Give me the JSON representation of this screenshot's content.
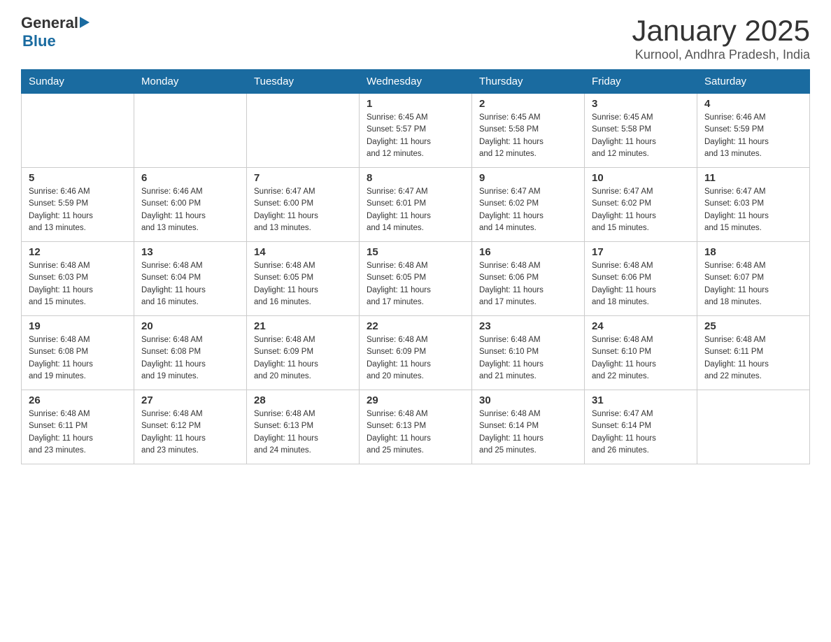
{
  "header": {
    "logo_general": "General",
    "logo_blue": "Blue",
    "month_title": "January 2025",
    "location": "Kurnool, Andhra Pradesh, India"
  },
  "days_of_week": [
    "Sunday",
    "Monday",
    "Tuesday",
    "Wednesday",
    "Thursday",
    "Friday",
    "Saturday"
  ],
  "weeks": [
    {
      "days": [
        {
          "date": "",
          "info": ""
        },
        {
          "date": "",
          "info": ""
        },
        {
          "date": "",
          "info": ""
        },
        {
          "date": "1",
          "info": "Sunrise: 6:45 AM\nSunset: 5:57 PM\nDaylight: 11 hours\nand 12 minutes."
        },
        {
          "date": "2",
          "info": "Sunrise: 6:45 AM\nSunset: 5:58 PM\nDaylight: 11 hours\nand 12 minutes."
        },
        {
          "date": "3",
          "info": "Sunrise: 6:45 AM\nSunset: 5:58 PM\nDaylight: 11 hours\nand 12 minutes."
        },
        {
          "date": "4",
          "info": "Sunrise: 6:46 AM\nSunset: 5:59 PM\nDaylight: 11 hours\nand 13 minutes."
        }
      ]
    },
    {
      "days": [
        {
          "date": "5",
          "info": "Sunrise: 6:46 AM\nSunset: 5:59 PM\nDaylight: 11 hours\nand 13 minutes."
        },
        {
          "date": "6",
          "info": "Sunrise: 6:46 AM\nSunset: 6:00 PM\nDaylight: 11 hours\nand 13 minutes."
        },
        {
          "date": "7",
          "info": "Sunrise: 6:47 AM\nSunset: 6:00 PM\nDaylight: 11 hours\nand 13 minutes."
        },
        {
          "date": "8",
          "info": "Sunrise: 6:47 AM\nSunset: 6:01 PM\nDaylight: 11 hours\nand 14 minutes."
        },
        {
          "date": "9",
          "info": "Sunrise: 6:47 AM\nSunset: 6:02 PM\nDaylight: 11 hours\nand 14 minutes."
        },
        {
          "date": "10",
          "info": "Sunrise: 6:47 AM\nSunset: 6:02 PM\nDaylight: 11 hours\nand 15 minutes."
        },
        {
          "date": "11",
          "info": "Sunrise: 6:47 AM\nSunset: 6:03 PM\nDaylight: 11 hours\nand 15 minutes."
        }
      ]
    },
    {
      "days": [
        {
          "date": "12",
          "info": "Sunrise: 6:48 AM\nSunset: 6:03 PM\nDaylight: 11 hours\nand 15 minutes."
        },
        {
          "date": "13",
          "info": "Sunrise: 6:48 AM\nSunset: 6:04 PM\nDaylight: 11 hours\nand 16 minutes."
        },
        {
          "date": "14",
          "info": "Sunrise: 6:48 AM\nSunset: 6:05 PM\nDaylight: 11 hours\nand 16 minutes."
        },
        {
          "date": "15",
          "info": "Sunrise: 6:48 AM\nSunset: 6:05 PM\nDaylight: 11 hours\nand 17 minutes."
        },
        {
          "date": "16",
          "info": "Sunrise: 6:48 AM\nSunset: 6:06 PM\nDaylight: 11 hours\nand 17 minutes."
        },
        {
          "date": "17",
          "info": "Sunrise: 6:48 AM\nSunset: 6:06 PM\nDaylight: 11 hours\nand 18 minutes."
        },
        {
          "date": "18",
          "info": "Sunrise: 6:48 AM\nSunset: 6:07 PM\nDaylight: 11 hours\nand 18 minutes."
        }
      ]
    },
    {
      "days": [
        {
          "date": "19",
          "info": "Sunrise: 6:48 AM\nSunset: 6:08 PM\nDaylight: 11 hours\nand 19 minutes."
        },
        {
          "date": "20",
          "info": "Sunrise: 6:48 AM\nSunset: 6:08 PM\nDaylight: 11 hours\nand 19 minutes."
        },
        {
          "date": "21",
          "info": "Sunrise: 6:48 AM\nSunset: 6:09 PM\nDaylight: 11 hours\nand 20 minutes."
        },
        {
          "date": "22",
          "info": "Sunrise: 6:48 AM\nSunset: 6:09 PM\nDaylight: 11 hours\nand 20 minutes."
        },
        {
          "date": "23",
          "info": "Sunrise: 6:48 AM\nSunset: 6:10 PM\nDaylight: 11 hours\nand 21 minutes."
        },
        {
          "date": "24",
          "info": "Sunrise: 6:48 AM\nSunset: 6:10 PM\nDaylight: 11 hours\nand 22 minutes."
        },
        {
          "date": "25",
          "info": "Sunrise: 6:48 AM\nSunset: 6:11 PM\nDaylight: 11 hours\nand 22 minutes."
        }
      ]
    },
    {
      "days": [
        {
          "date": "26",
          "info": "Sunrise: 6:48 AM\nSunset: 6:11 PM\nDaylight: 11 hours\nand 23 minutes."
        },
        {
          "date": "27",
          "info": "Sunrise: 6:48 AM\nSunset: 6:12 PM\nDaylight: 11 hours\nand 23 minutes."
        },
        {
          "date": "28",
          "info": "Sunrise: 6:48 AM\nSunset: 6:13 PM\nDaylight: 11 hours\nand 24 minutes."
        },
        {
          "date": "29",
          "info": "Sunrise: 6:48 AM\nSunset: 6:13 PM\nDaylight: 11 hours\nand 25 minutes."
        },
        {
          "date": "30",
          "info": "Sunrise: 6:48 AM\nSunset: 6:14 PM\nDaylight: 11 hours\nand 25 minutes."
        },
        {
          "date": "31",
          "info": "Sunrise: 6:47 AM\nSunset: 6:14 PM\nDaylight: 11 hours\nand 26 minutes."
        },
        {
          "date": "",
          "info": ""
        }
      ]
    }
  ]
}
